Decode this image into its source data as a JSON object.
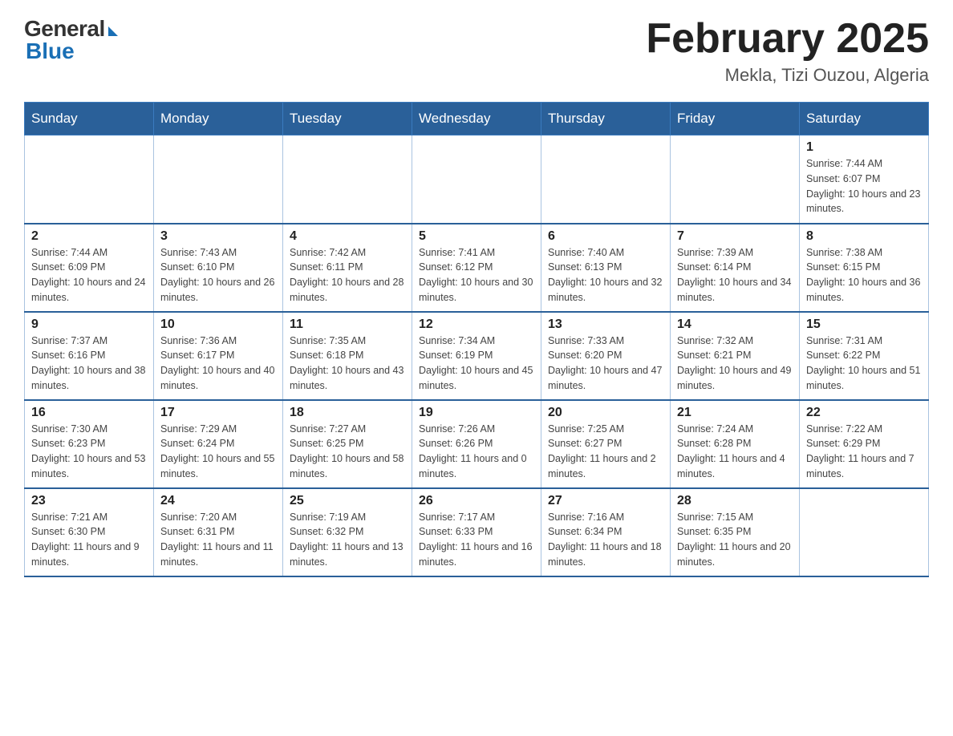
{
  "logo": {
    "general": "General",
    "blue": "Blue"
  },
  "header": {
    "title": "February 2025",
    "subtitle": "Mekla, Tizi Ouzou, Algeria"
  },
  "days_of_week": [
    "Sunday",
    "Monday",
    "Tuesday",
    "Wednesday",
    "Thursday",
    "Friday",
    "Saturday"
  ],
  "weeks": [
    [
      {
        "day": "",
        "info": ""
      },
      {
        "day": "",
        "info": ""
      },
      {
        "day": "",
        "info": ""
      },
      {
        "day": "",
        "info": ""
      },
      {
        "day": "",
        "info": ""
      },
      {
        "day": "",
        "info": ""
      },
      {
        "day": "1",
        "info": "Sunrise: 7:44 AM\nSunset: 6:07 PM\nDaylight: 10 hours and 23 minutes."
      }
    ],
    [
      {
        "day": "2",
        "info": "Sunrise: 7:44 AM\nSunset: 6:09 PM\nDaylight: 10 hours and 24 minutes."
      },
      {
        "day": "3",
        "info": "Sunrise: 7:43 AM\nSunset: 6:10 PM\nDaylight: 10 hours and 26 minutes."
      },
      {
        "day": "4",
        "info": "Sunrise: 7:42 AM\nSunset: 6:11 PM\nDaylight: 10 hours and 28 minutes."
      },
      {
        "day": "5",
        "info": "Sunrise: 7:41 AM\nSunset: 6:12 PM\nDaylight: 10 hours and 30 minutes."
      },
      {
        "day": "6",
        "info": "Sunrise: 7:40 AM\nSunset: 6:13 PM\nDaylight: 10 hours and 32 minutes."
      },
      {
        "day": "7",
        "info": "Sunrise: 7:39 AM\nSunset: 6:14 PM\nDaylight: 10 hours and 34 minutes."
      },
      {
        "day": "8",
        "info": "Sunrise: 7:38 AM\nSunset: 6:15 PM\nDaylight: 10 hours and 36 minutes."
      }
    ],
    [
      {
        "day": "9",
        "info": "Sunrise: 7:37 AM\nSunset: 6:16 PM\nDaylight: 10 hours and 38 minutes."
      },
      {
        "day": "10",
        "info": "Sunrise: 7:36 AM\nSunset: 6:17 PM\nDaylight: 10 hours and 40 minutes."
      },
      {
        "day": "11",
        "info": "Sunrise: 7:35 AM\nSunset: 6:18 PM\nDaylight: 10 hours and 43 minutes."
      },
      {
        "day": "12",
        "info": "Sunrise: 7:34 AM\nSunset: 6:19 PM\nDaylight: 10 hours and 45 minutes."
      },
      {
        "day": "13",
        "info": "Sunrise: 7:33 AM\nSunset: 6:20 PM\nDaylight: 10 hours and 47 minutes."
      },
      {
        "day": "14",
        "info": "Sunrise: 7:32 AM\nSunset: 6:21 PM\nDaylight: 10 hours and 49 minutes."
      },
      {
        "day": "15",
        "info": "Sunrise: 7:31 AM\nSunset: 6:22 PM\nDaylight: 10 hours and 51 minutes."
      }
    ],
    [
      {
        "day": "16",
        "info": "Sunrise: 7:30 AM\nSunset: 6:23 PM\nDaylight: 10 hours and 53 minutes."
      },
      {
        "day": "17",
        "info": "Sunrise: 7:29 AM\nSunset: 6:24 PM\nDaylight: 10 hours and 55 minutes."
      },
      {
        "day": "18",
        "info": "Sunrise: 7:27 AM\nSunset: 6:25 PM\nDaylight: 10 hours and 58 minutes."
      },
      {
        "day": "19",
        "info": "Sunrise: 7:26 AM\nSunset: 6:26 PM\nDaylight: 11 hours and 0 minutes."
      },
      {
        "day": "20",
        "info": "Sunrise: 7:25 AM\nSunset: 6:27 PM\nDaylight: 11 hours and 2 minutes."
      },
      {
        "day": "21",
        "info": "Sunrise: 7:24 AM\nSunset: 6:28 PM\nDaylight: 11 hours and 4 minutes."
      },
      {
        "day": "22",
        "info": "Sunrise: 7:22 AM\nSunset: 6:29 PM\nDaylight: 11 hours and 7 minutes."
      }
    ],
    [
      {
        "day": "23",
        "info": "Sunrise: 7:21 AM\nSunset: 6:30 PM\nDaylight: 11 hours and 9 minutes."
      },
      {
        "day": "24",
        "info": "Sunrise: 7:20 AM\nSunset: 6:31 PM\nDaylight: 11 hours and 11 minutes."
      },
      {
        "day": "25",
        "info": "Sunrise: 7:19 AM\nSunset: 6:32 PM\nDaylight: 11 hours and 13 minutes."
      },
      {
        "day": "26",
        "info": "Sunrise: 7:17 AM\nSunset: 6:33 PM\nDaylight: 11 hours and 16 minutes."
      },
      {
        "day": "27",
        "info": "Sunrise: 7:16 AM\nSunset: 6:34 PM\nDaylight: 11 hours and 18 minutes."
      },
      {
        "day": "28",
        "info": "Sunrise: 7:15 AM\nSunset: 6:35 PM\nDaylight: 11 hours and 20 minutes."
      },
      {
        "day": "",
        "info": ""
      }
    ]
  ]
}
